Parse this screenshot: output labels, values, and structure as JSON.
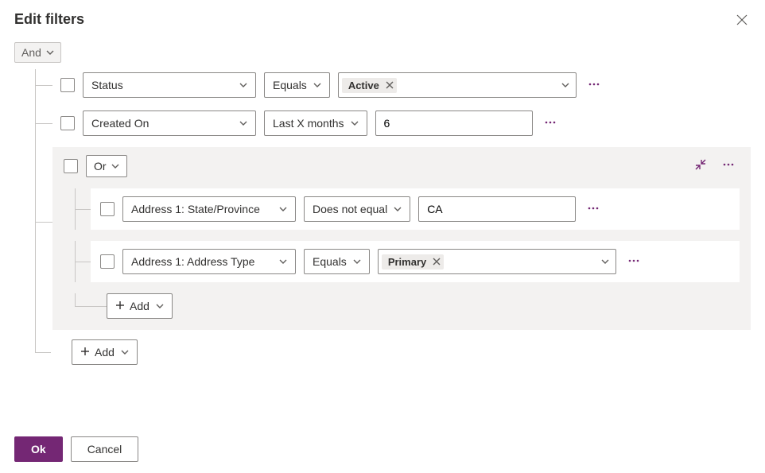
{
  "title": "Edit filters",
  "rootOperator": "And",
  "rows": [
    {
      "field": "Status",
      "operator": "Equals",
      "valueTag": "Active"
    },
    {
      "field": "Created On",
      "operator": "Last X months",
      "valueText": "6"
    }
  ],
  "group": {
    "operator": "Or",
    "rows": [
      {
        "field": "Address 1: State/Province",
        "operator": "Does not equal",
        "valueText": "CA"
      },
      {
        "field": "Address 1: Address Type",
        "operator": "Equals",
        "valueTag": "Primary"
      }
    ],
    "addLabel": "Add"
  },
  "addLabel": "Add",
  "buttons": {
    "ok": "Ok",
    "cancel": "Cancel"
  }
}
